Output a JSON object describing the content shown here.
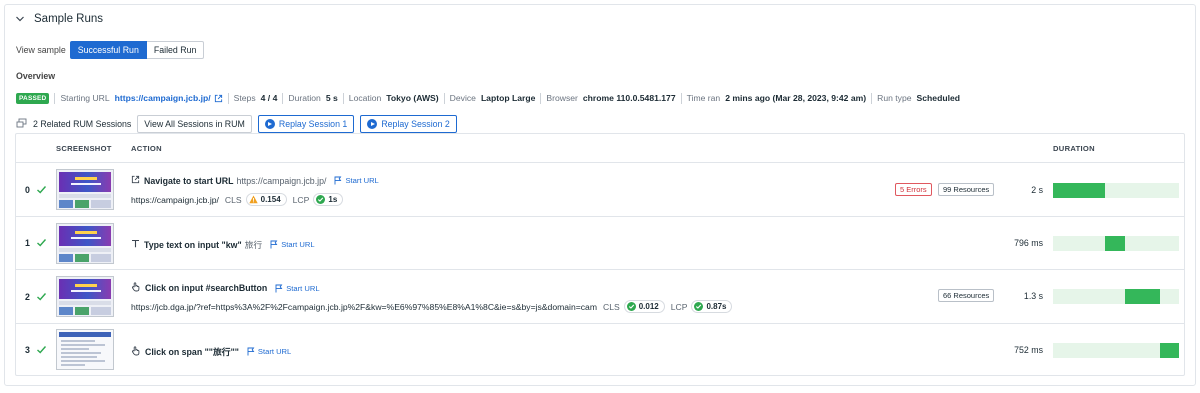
{
  "section": {
    "title": "Sample Runs"
  },
  "view_sample": {
    "label": "View sample",
    "options": [
      "Successful Run",
      "Failed Run"
    ],
    "selected": "Successful Run"
  },
  "overview": {
    "heading": "Overview",
    "status_badge": "PASSED",
    "starting_url_label": "Starting URL",
    "starting_url": "https://campaign.jcb.jp/",
    "steps_label": "Steps",
    "steps": "4 / 4",
    "duration_label": "Duration",
    "duration": "5 s",
    "location_label": "Location",
    "location": "Tokyo (AWS)",
    "device_label": "Device",
    "device": "Laptop Large",
    "browser_label": "Browser",
    "browser": "chrome 110.0.5481.177",
    "time_ran_label": "Time ran",
    "time_ran": "2 mins ago (Mar 28, 2023, 9:42 am)",
    "run_type_label": "Run type",
    "run_type": "Scheduled"
  },
  "rum": {
    "related_text": "2 Related RUM Sessions",
    "view_all": "View All Sessions in RUM",
    "replay_1": "Replay Session 1",
    "replay_2": "Replay Session 2"
  },
  "table": {
    "headers": {
      "screenshot": "SCREENSHOT",
      "action": "ACTION",
      "duration": "DURATION"
    },
    "rows": [
      {
        "index": "0",
        "icon": "external-link-icon",
        "action": "Navigate to start URL",
        "detail": "https://campaign.jcb.jp/",
        "start_url": "Start URL",
        "url": "https://campaign.jcb.jp/",
        "cls_label": "CLS",
        "cls": "0.154",
        "cls_status": "warning",
        "lcp_label": "LCP",
        "lcp": "1s",
        "errors": "5 Errors",
        "resources": "99 Resources",
        "duration": "2 s",
        "bar_start": 0.0,
        "bar_width": 0.41
      },
      {
        "index": "1",
        "icon": "text-input-icon",
        "action": "Type text on input \"kw\"",
        "detail": "旅行",
        "start_url": "Start URL",
        "duration": "796 ms",
        "bar_start": 0.41,
        "bar_width": 0.16
      },
      {
        "index": "2",
        "icon": "pointer-hand-icon",
        "action": "Click on input #searchButton",
        "start_url": "Start URL",
        "url": "https://jcb.dga.jp/?ref=https%3A%2F%2Fcampaign.jcb.jp%2F&kw=%E6%97%85%E8%A1%8C&ie=s&by=js&domain=cam",
        "cls_label": "CLS",
        "cls": "0.012",
        "cls_status": "good",
        "lcp_label": "LCP",
        "lcp": "0.87s",
        "resources": "66 Resources",
        "duration": "1.3 s",
        "bar_start": 0.57,
        "bar_width": 0.28
      },
      {
        "index": "3",
        "icon": "pointer-hand-icon",
        "action": "Click on span \"\"旅行\"\"",
        "start_url": "Start URL",
        "duration": "752 ms",
        "bar_start": 0.85,
        "bar_width": 0.15
      }
    ]
  },
  "colors": {
    "accent": "#1e6ad1",
    "success": "#2ea84f",
    "bar": "#34b75a",
    "bar_track": "#e6f5e9",
    "error": "#d0323a"
  }
}
